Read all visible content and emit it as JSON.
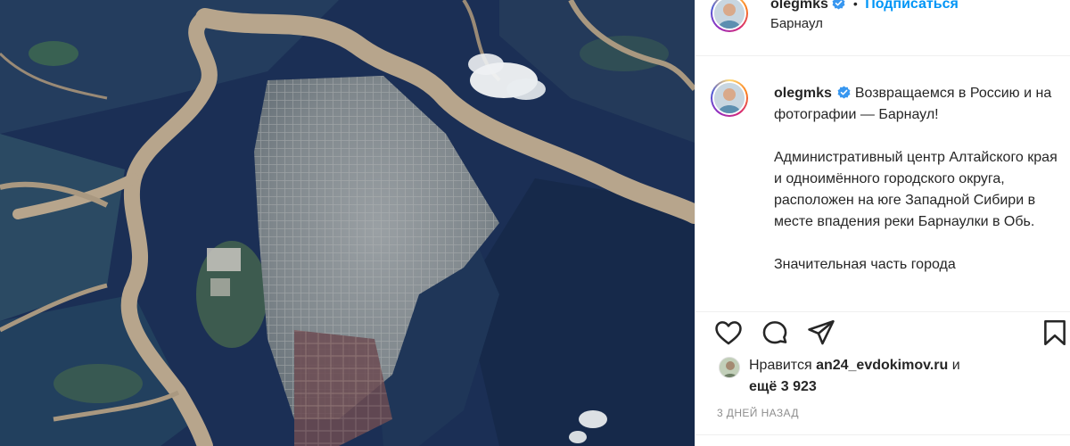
{
  "post": {
    "username": "olegmks",
    "follow_label": "Подписаться",
    "separator": "•",
    "location": "Барнаул",
    "caption": {
      "username": "olegmks",
      "paragraphs": [
        "Возвращаемся в Россию и на фотографии — Барнаул!",
        "Административный центр Алтайского края и одноимённого городского округа, расположен на юге Западной Сибири в месте впадения реки Барнаулки в Обь.",
        "Значительная часть города"
      ]
    },
    "likes": {
      "prefix": "Нравится",
      "user": "an24_evdokimov.ru",
      "conjunction": "и",
      "more": "ещё 3 923"
    },
    "timestamp": "3 дней назад"
  },
  "icons": {
    "like": "heart-icon",
    "comment": "comment-icon",
    "share": "paper-plane-icon",
    "save": "bookmark-icon",
    "verified": "verified-badge-icon"
  },
  "colors": {
    "accent_blue": "#0095f6",
    "muted": "#8e8e8e",
    "text": "#262626",
    "river": "#b9a68c",
    "forest": "#1e3b63"
  }
}
